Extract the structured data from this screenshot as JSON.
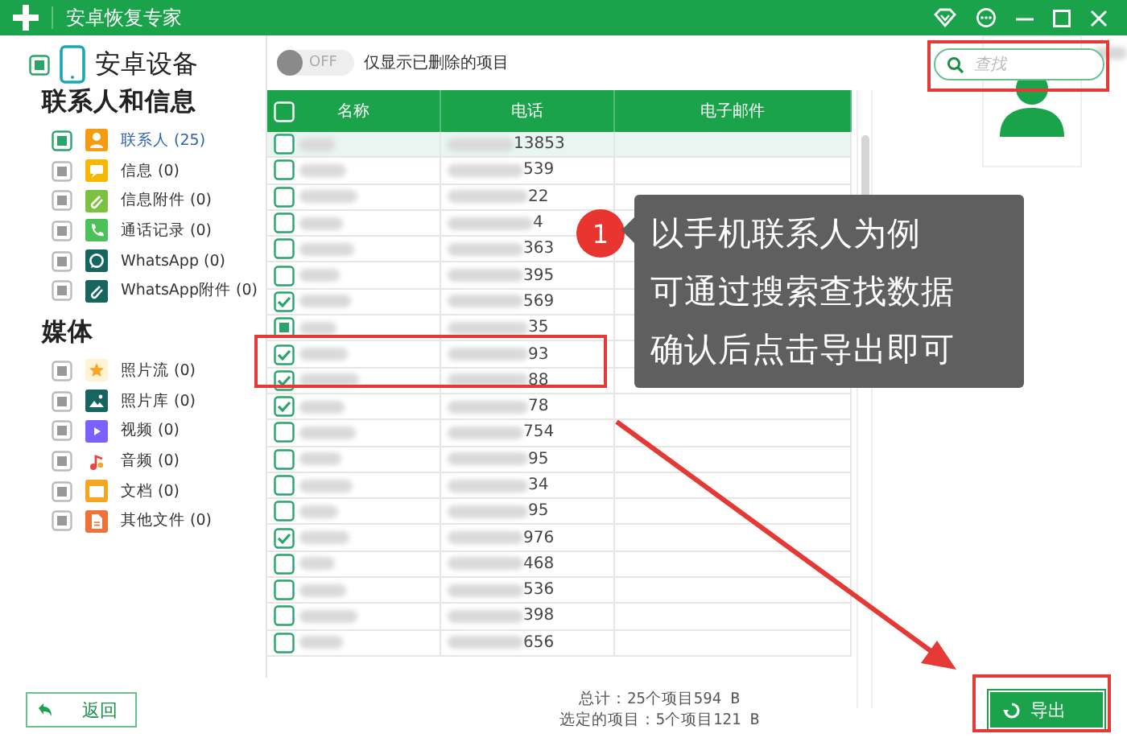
{
  "window": {
    "title": "安卓恢复专家"
  },
  "sidebar": {
    "device": {
      "label": "安卓设备",
      "partial": true
    },
    "sections": [
      {
        "title": "联系人和信息",
        "items": [
          {
            "label": "联系人 (25)",
            "kind": "contacts",
            "partial": true,
            "disabled": false,
            "selected": true
          },
          {
            "label": "信息 (0)",
            "kind": "messages",
            "partial": true,
            "disabled": true,
            "selected": false
          },
          {
            "label": "信息附件 (0)",
            "kind": "attachments",
            "partial": true,
            "disabled": true,
            "selected": false
          },
          {
            "label": "通话记录 (0)",
            "kind": "calls",
            "partial": true,
            "disabled": true,
            "selected": false
          },
          {
            "label": "WhatsApp (0)",
            "kind": "whatsapp",
            "partial": true,
            "disabled": true,
            "selected": false
          },
          {
            "label": "WhatsApp附件 (0)",
            "kind": "whatsapp_attachments",
            "partial": true,
            "disabled": true,
            "selected": false
          }
        ]
      },
      {
        "title": "媒体",
        "items": [
          {
            "label": "照片流 (0)",
            "kind": "photostream",
            "partial": true,
            "disabled": true,
            "selected": false
          },
          {
            "label": "照片库 (0)",
            "kind": "photos",
            "partial": true,
            "disabled": true,
            "selected": false
          },
          {
            "label": "视频 (0)",
            "kind": "video",
            "partial": true,
            "disabled": true,
            "selected": false
          },
          {
            "label": "音频 (0)",
            "kind": "audio",
            "partial": true,
            "disabled": true,
            "selected": false
          },
          {
            "label": "文档 (0)",
            "kind": "documents",
            "partial": true,
            "disabled": true,
            "selected": false
          },
          {
            "label": "其他文件 (0)",
            "kind": "other",
            "partial": true,
            "disabled": true,
            "selected": false
          }
        ]
      }
    ]
  },
  "toolbar": {
    "toggle": {
      "label": "OFF",
      "on": false
    },
    "filter_label": "仅显示已删除的项目"
  },
  "search": {
    "placeholder": "查找"
  },
  "table": {
    "header_checked": false,
    "columns": [
      "名称",
      "电话",
      "电子邮件"
    ],
    "rows": [
      {
        "checked": false,
        "partial": false,
        "selected": true,
        "phone": "13853"
      },
      {
        "checked": false,
        "partial": false,
        "selected": false,
        "phone": "539"
      },
      {
        "checked": false,
        "partial": false,
        "selected": false,
        "phone": "22"
      },
      {
        "checked": false,
        "partial": false,
        "selected": false,
        "phone": "4"
      },
      {
        "checked": false,
        "partial": false,
        "selected": false,
        "phone": "363"
      },
      {
        "checked": false,
        "partial": false,
        "selected": false,
        "phone": "395"
      },
      {
        "checked": true,
        "partial": false,
        "selected": false,
        "phone": "569"
      },
      {
        "checked": false,
        "partial": true,
        "selected": false,
        "phone": "35"
      },
      {
        "checked": true,
        "partial": false,
        "selected": false,
        "phone": "93"
      },
      {
        "checked": true,
        "partial": false,
        "selected": false,
        "phone": "88"
      },
      {
        "checked": true,
        "partial": false,
        "selected": false,
        "phone": "78"
      },
      {
        "checked": false,
        "partial": false,
        "selected": false,
        "phone": "754"
      },
      {
        "checked": false,
        "partial": false,
        "selected": false,
        "phone": "95"
      },
      {
        "checked": false,
        "partial": false,
        "selected": false,
        "phone": "34"
      },
      {
        "checked": false,
        "partial": false,
        "selected": false,
        "phone": "95"
      },
      {
        "checked": true,
        "partial": false,
        "selected": false,
        "phone": "976"
      },
      {
        "checked": false,
        "partial": false,
        "selected": false,
        "phone": "468"
      },
      {
        "checked": false,
        "partial": false,
        "selected": false,
        "phone": "536"
      },
      {
        "checked": false,
        "partial": false,
        "selected": false,
        "phone": "398"
      },
      {
        "checked": false,
        "partial": false,
        "selected": false,
        "phone": "656"
      }
    ]
  },
  "footer": {
    "back": "返回",
    "summary": [
      "总计：25个项目594 B",
      "选定的项目：5个项目121 B"
    ],
    "export": "导出"
  },
  "annotation": {
    "step": "1",
    "lines": [
      "以手机联系人为例",
      "可通过搜索查找数据",
      "确认后点击导出即可"
    ]
  }
}
